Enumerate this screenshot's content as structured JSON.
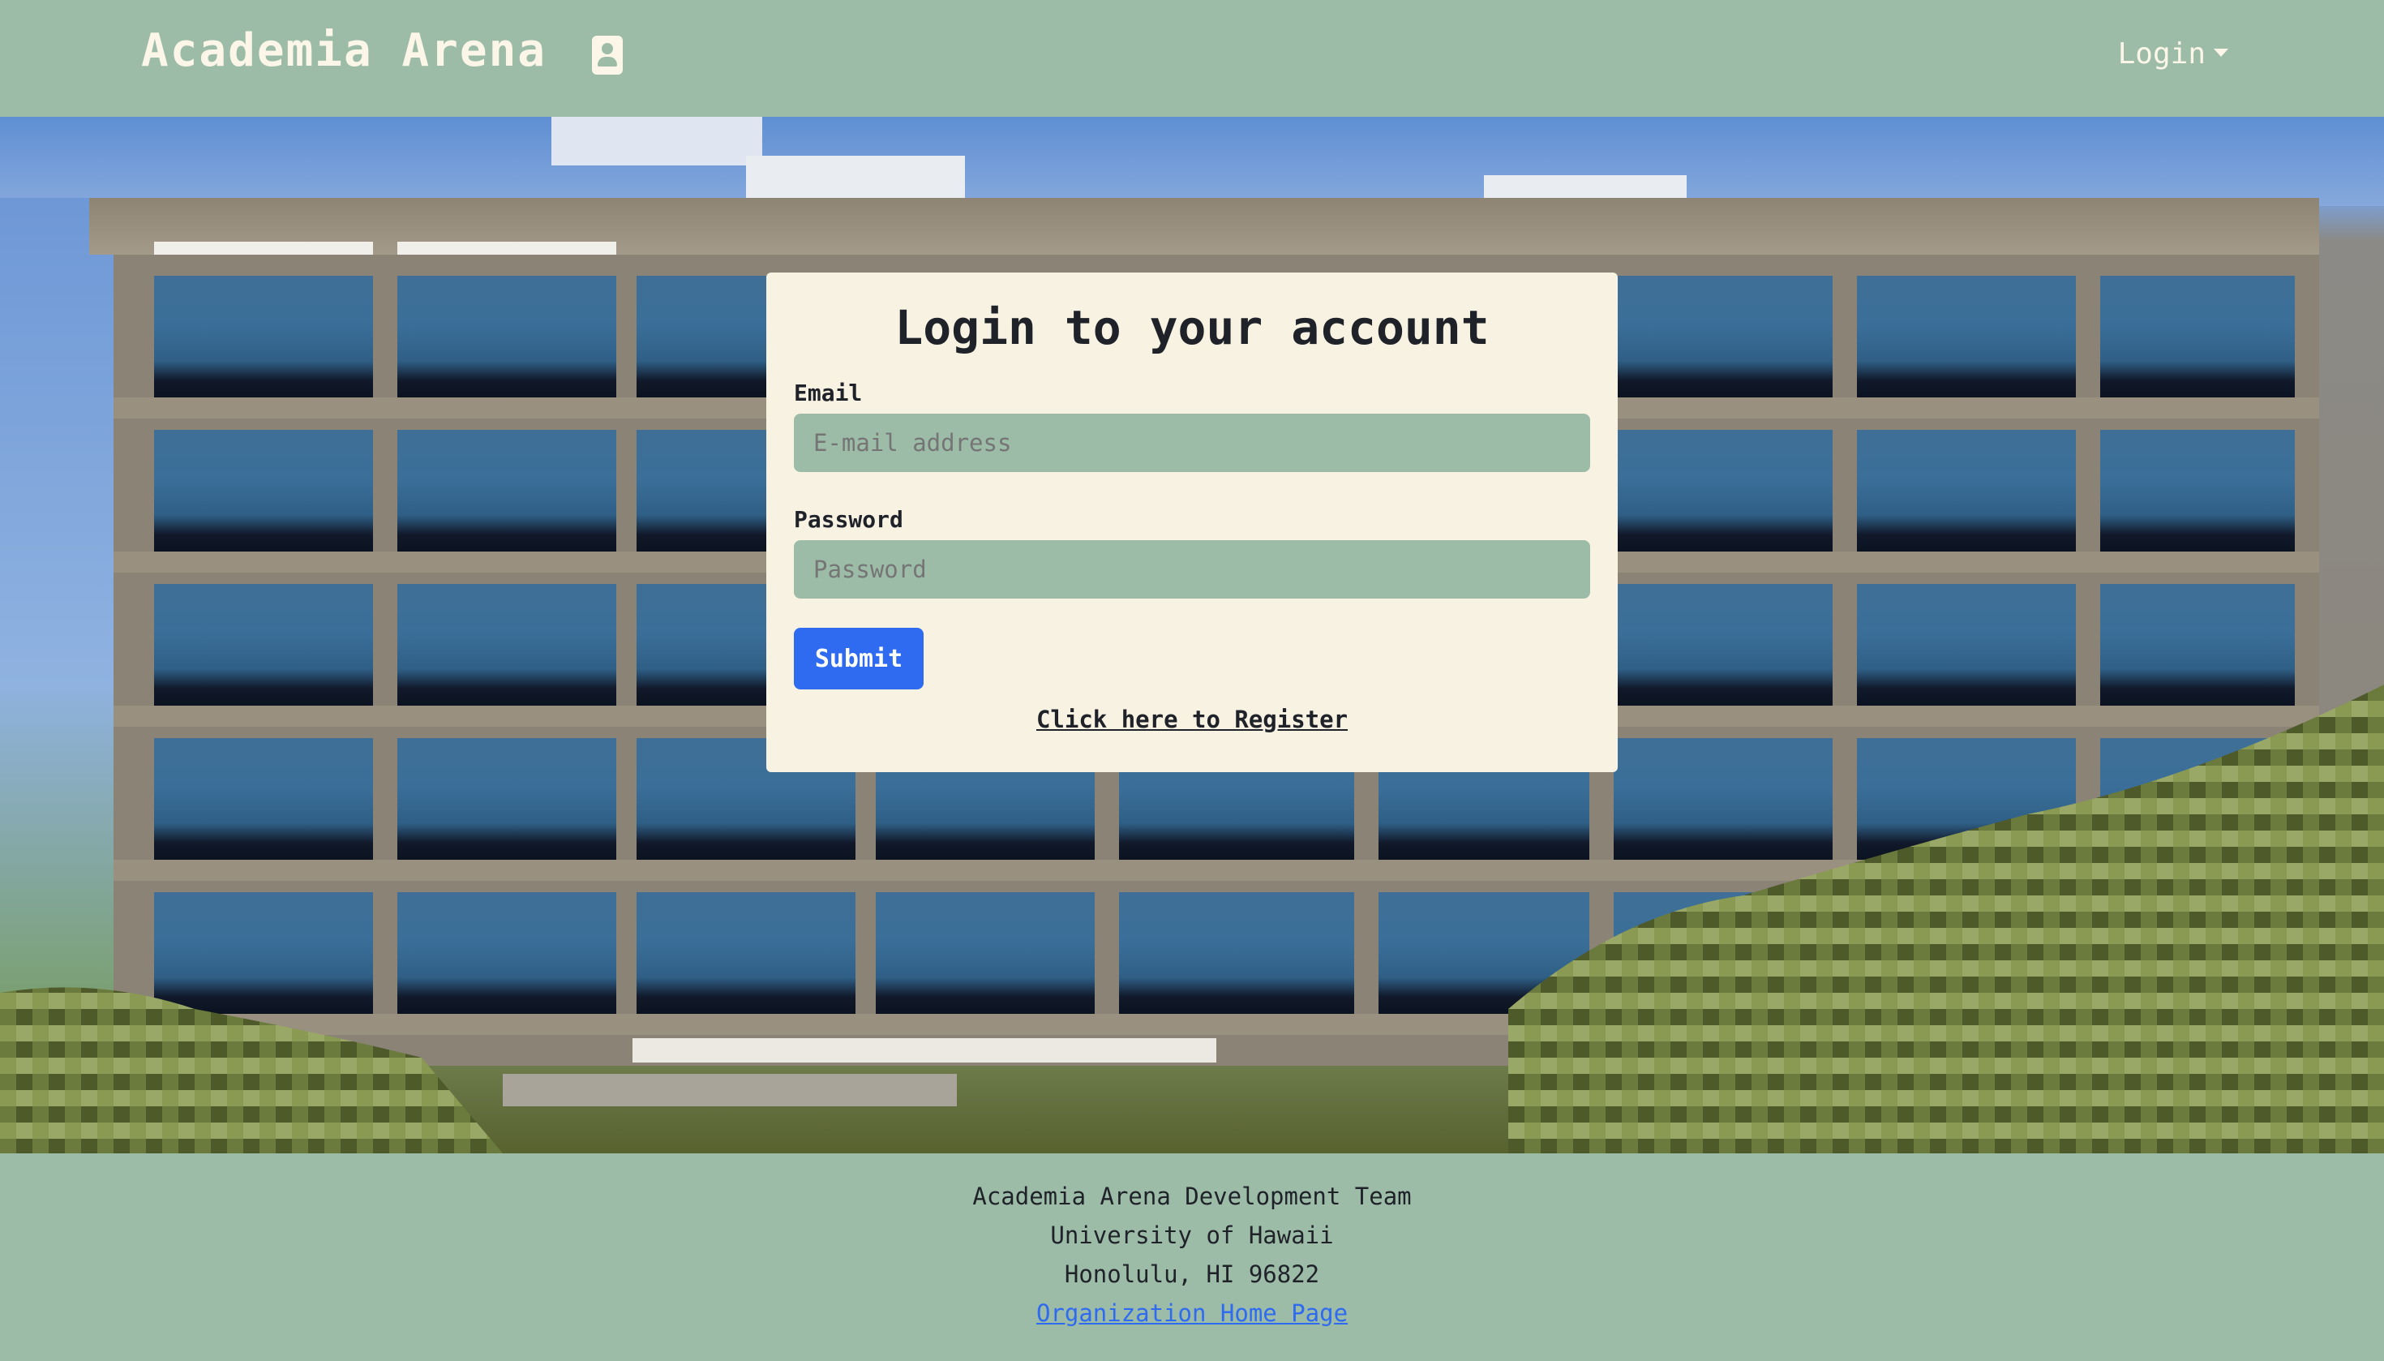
{
  "navbar": {
    "brand": "Academia Arena",
    "brand_icon": "id-badge-icon",
    "login_label": "Login"
  },
  "login_card": {
    "title": "Login to your account",
    "email_label": "Email",
    "email_placeholder": "E-mail address",
    "email_value": "",
    "password_label": "Password",
    "password_placeholder": "Password",
    "password_value": "",
    "submit_label": "Submit",
    "register_link": "Click here to Register"
  },
  "footer": {
    "team": "Academia Arena Development Team",
    "university": "University of Hawaii",
    "address": "Honolulu, HI 96822",
    "home_link": "Organization Home Page"
  },
  "colors": {
    "navbar_bg": "#9dbca8",
    "card_bg": "#f8f2e3",
    "primary_button": "#2f6bf0",
    "link": "#2f6bf0"
  }
}
